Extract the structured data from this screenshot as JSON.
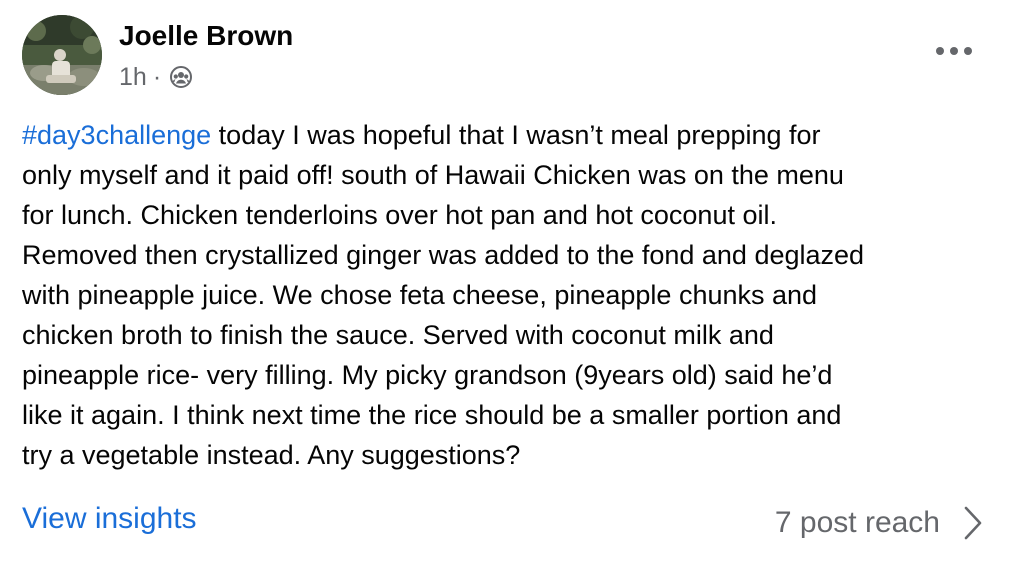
{
  "post": {
    "author_name": "Joelle Brown",
    "timestamp": "1h",
    "separator": "·",
    "audience_icon": "groups-icon",
    "more_icon": "more-horizontal-icon",
    "hashtag": "#day3challenge",
    "body_lines": [
      " today I was hopeful that I wasn’t meal prepping for",
      "only myself and it paid off! south of Hawaii Chicken was on the menu",
      "for lunch. Chicken tenderloins over hot pan and hot coconut oil.",
      "Removed then crystallized ginger was added to the fond and deglazed",
      "with pineapple juice. We chose feta cheese, pineapple chunks and",
      "chicken broth to finish the sauce. Served with coconut milk and",
      "pineapple rice- very filling. My picky grandson (9years old) said he’d",
      "like it again. I think next time the rice should be a smaller portion and",
      "try a vegetable instead. Any suggestions?"
    ]
  },
  "footer": {
    "insights_label": "View insights",
    "reach_label": "7 post reach",
    "chevron_icon": "chevron-right-icon"
  },
  "colors": {
    "link_blue": "#1a6ed8",
    "secondary_gray": "#65676b",
    "text_black": "#050505"
  }
}
